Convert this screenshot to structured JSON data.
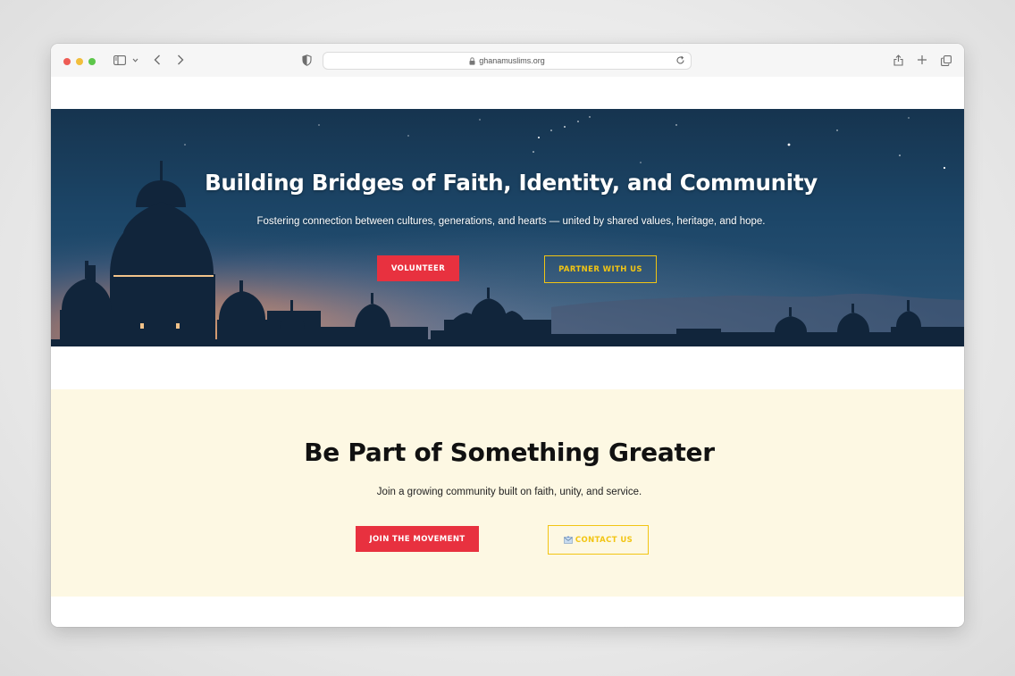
{
  "browser": {
    "url": "ghanamuslims.org"
  },
  "hero": {
    "title": "Building Bridges of Faith, Identity, and Community",
    "subtitle": "Fostering connection between cultures, generations, and hearts — united by shared values, heritage, and hope.",
    "volunteer_label": "VOLUNTEER",
    "partner_label": "PARTNER WITH US"
  },
  "cta": {
    "title": "Be Part of Something Greater",
    "subtitle": "Join a growing community built on faith, unity, and service.",
    "join_label": "JOIN THE MOVEMENT",
    "contact_label": "CONTACT US"
  },
  "colors": {
    "accent_red": "#e8313f",
    "accent_yellow": "#f2c513",
    "cta_background": "#fdf8e3",
    "hero_sky": "#1c4a6c"
  },
  "icons": [
    "sidebar-icon",
    "chevron-down-icon",
    "back-icon",
    "forward-icon",
    "shield-icon",
    "lock-icon",
    "reload-icon",
    "share-icon",
    "new-tab-icon",
    "tabs-overview-icon",
    "envelope-icon"
  ]
}
